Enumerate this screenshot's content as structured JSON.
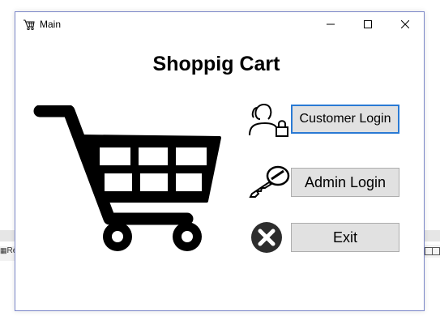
{
  "window": {
    "title": "Main"
  },
  "main": {
    "heading": "Shoppig Cart"
  },
  "buttons": {
    "customer_login": "Customer Login",
    "admin_login": "Admin Login",
    "exit": "Exit"
  },
  "background": {
    "tab_text": "Re"
  },
  "icons": {
    "title": "shopping-cart-icon",
    "cart": "shopping-cart-icon",
    "customer": "user-lock-icon",
    "admin": "key-icon",
    "exit": "close-circle-icon"
  },
  "colors": {
    "window_border": "#7a86c8",
    "focus_border": "#2a7ad4",
    "button_bg": "#e1e1e1"
  }
}
